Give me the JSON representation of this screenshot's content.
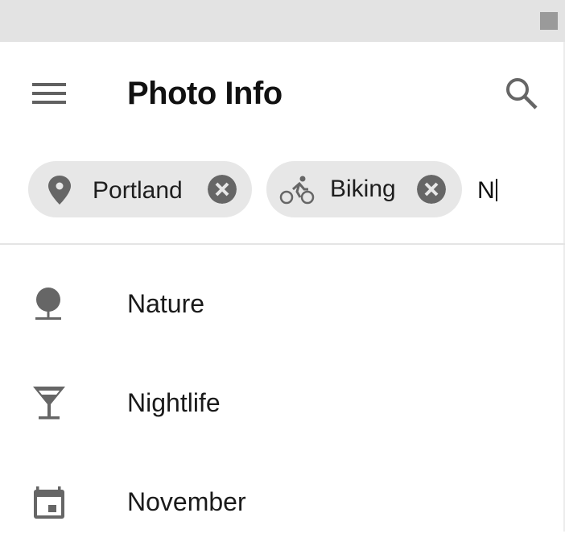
{
  "statusbar": {
    "indicator": "square"
  },
  "header": {
    "title": "Photo Info",
    "menu_icon": "menu-icon",
    "search_icon": "search-icon"
  },
  "chips": [
    {
      "label": "Portland",
      "icon": "location-pin-icon"
    },
    {
      "label": "Biking",
      "icon": "bike-icon"
    }
  ],
  "search_input": {
    "value": "N"
  },
  "suggestions": [
    {
      "label": "Nature",
      "icon": "tree-icon"
    },
    {
      "label": "Nightlife",
      "icon": "cocktail-icon"
    },
    {
      "label": "November",
      "icon": "calendar-icon"
    }
  ],
  "colors": {
    "icon": "#666666",
    "chip_bg": "#e7e7e7",
    "statusbar": "#e3e3e3"
  }
}
